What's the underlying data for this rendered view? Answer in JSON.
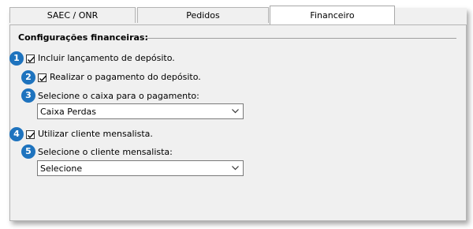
{
  "tabs": [
    {
      "label": "SAEC / ONR"
    },
    {
      "label": "Pedidos"
    },
    {
      "label": "Financeiro"
    }
  ],
  "section": {
    "title": "Configurações financeiras:"
  },
  "badges": [
    "1",
    "2",
    "3",
    "4",
    "5"
  ],
  "options": {
    "include_deposit": {
      "label": "Incluir lançamento de depósito.",
      "checked": true
    },
    "pay_deposit": {
      "label": "Realizar o pagamento do depósito.",
      "checked": true
    },
    "cash_select": {
      "label": "Selecione o caixa para o pagamento:",
      "value": "Caixa  Perdas"
    },
    "monthly_client": {
      "label": "Utilizar cliente mensalista.",
      "checked": true
    },
    "client_select": {
      "label": "Selecione o cliente mensalista:",
      "value": "Selecione"
    }
  },
  "colors": {
    "badge": "#1e73be",
    "panel": "#f0f0f0"
  }
}
